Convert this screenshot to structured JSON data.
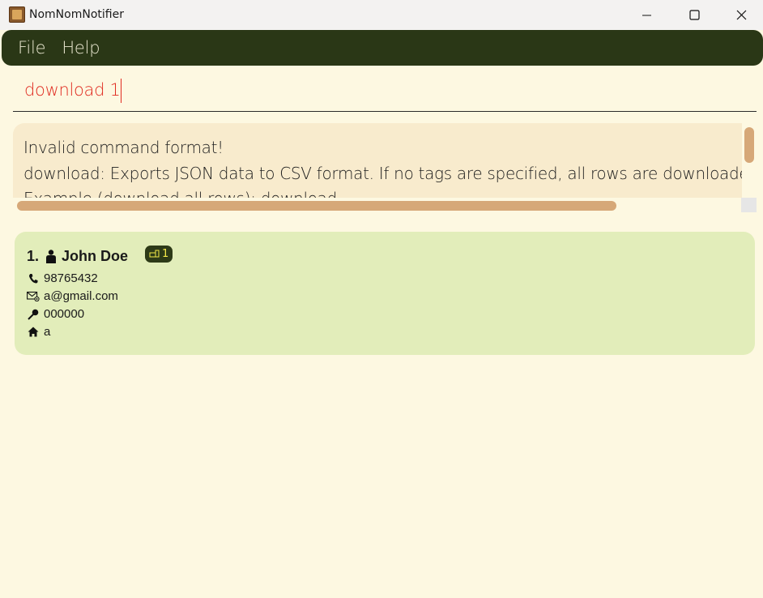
{
  "window": {
    "title": "NomNomNotifier",
    "controls": {
      "minimize": "minimize-icon",
      "maximize": "maximize-icon",
      "close": "close-icon"
    }
  },
  "menu": {
    "items": [
      {
        "label": "File"
      },
      {
        "label": "Help"
      }
    ]
  },
  "command": {
    "value": "download 1",
    "text_color": "#e02b20"
  },
  "result": {
    "lines": [
      "Invalid command format!",
      "download: Exports JSON data to CSV format. If no tags are specified, all rows are downloaded. Parameters: [t/TAG]...",
      "Example (download all rows): download"
    ]
  },
  "persons": [
    {
      "index": "1.",
      "name": "John Doe",
      "tag": {
        "icon": "tag-icon",
        "label": "1"
      },
      "phone": "98765432",
      "email": "a@gmail.com",
      "postal": "000000",
      "address": "a"
    }
  ],
  "colors": {
    "background": "#fdf8e1",
    "menubar": "#2a3716",
    "result_bg": "#f8ebcd",
    "card_bg": "#e2edba",
    "scroll_thumb": "#d6a878",
    "tag_bg": "#2d3a17",
    "tag_text": "#f4e94a"
  }
}
